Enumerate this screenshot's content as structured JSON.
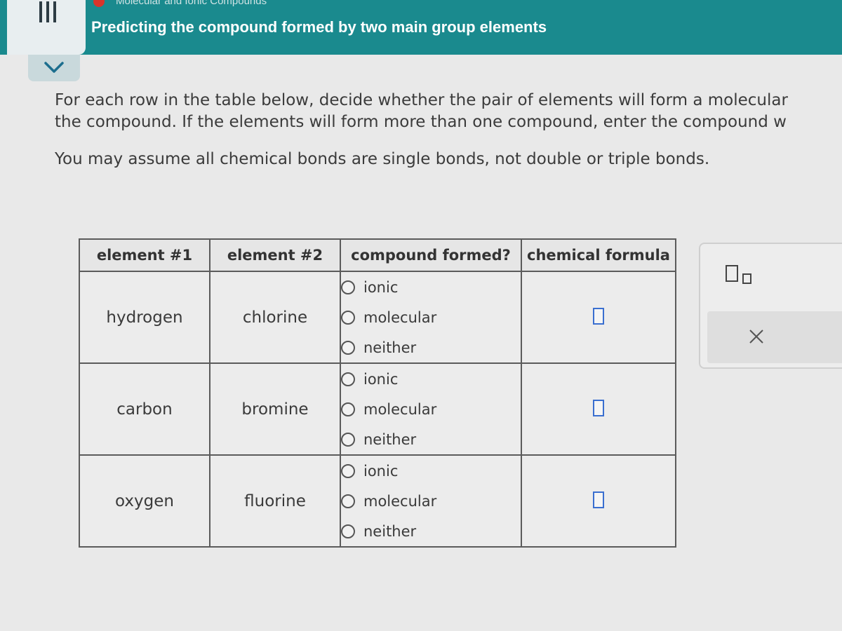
{
  "header": {
    "topic": "Molecular and Ionic Compounds",
    "title": "Predicting the compound formed by two main group elements"
  },
  "instructions": {
    "line1": "For each row in the table below, decide whether the pair of elements will form a molecular",
    "line2": "the compound. If the elements will form more than one compound, enter the compound w",
    "line3": "You may assume all chemical bonds are single bonds, not double or triple bonds."
  },
  "table": {
    "headers": [
      "element #1",
      "element #2",
      "compound formed?",
      "chemical formula"
    ],
    "rows": [
      {
        "element1": "hydrogen",
        "element2": "chlorine",
        "options": [
          "ionic",
          "molecular",
          "neither"
        ],
        "formula": ""
      },
      {
        "element1": "carbon",
        "element2": "bromine",
        "options": [
          "ionic",
          "molecular",
          "neither"
        ],
        "formula": ""
      },
      {
        "element1": "oxygen",
        "element2": "fluorine",
        "options": [
          "ionic",
          "molecular",
          "neither"
        ],
        "formula": ""
      }
    ]
  },
  "side_panel": {
    "superscript_icon": "superscript-box-icon",
    "clear_icon": "close-x-icon"
  },
  "colors": {
    "header_bg": "#1a8a8e",
    "topic_dot": "#d9342b",
    "input_border": "#3a6fd0"
  }
}
